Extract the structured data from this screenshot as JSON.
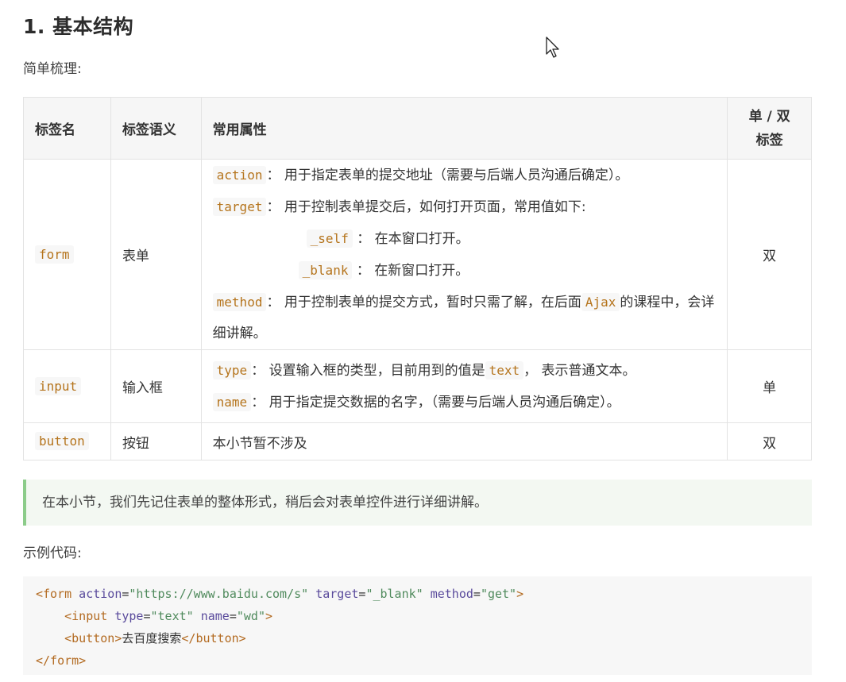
{
  "heading": "1. 基本结构",
  "intro": "简单梳理:",
  "table": {
    "headers": {
      "name": "标签名",
      "meaning": "标签语义",
      "attrs": "常用属性",
      "type_line1": "单 / 双",
      "type_line2": "标签"
    },
    "form": {
      "tag": "form",
      "meaning": "表单",
      "type": "双",
      "action_code": "action",
      "action_text": "： 用于指定表单的提交地址（需要与后端人员沟通后确定）。",
      "target_code": "target",
      "target_text": "： 用于控制表单提交后，如何打开页面，常用值如下:",
      "self_code": "_self",
      "self_text": " ： 在本窗口打开。",
      "blank_code": "_blank",
      "blank_text": " ： 在新窗口打开。",
      "method_code": "method",
      "method_text": "： 用于控制表单的提交方式，暂时只需了解，在后面",
      "ajax_code": "Ajax",
      "method_text2": "的课程中，会详细讲解。"
    },
    "input": {
      "tag": "input",
      "meaning": "输入框",
      "type": "单",
      "type_code": "type",
      "type_text1": "： 设置输入框的类型，目前用到的值是",
      "text_code": "text",
      "type_text2": "， 表示普通文本。",
      "name_code": "name",
      "name_text": "： 用于指定提交数据的名字，（需要与后端人员沟通后确定）。"
    },
    "button": {
      "tag": "button",
      "meaning": "按钮",
      "attrs": "本小节暂不涉及",
      "type": "双"
    }
  },
  "tip": "在本小节，我们先记住表单的整体形式，稍后会对表单控件进行详细讲解。",
  "example_label": "示例代码:",
  "code": {
    "l1_open": "<form",
    "l1_attr1": " action",
    "l1_eq1": "=",
    "l1_val1": "\"https://www.baidu.com/s\"",
    "l1_attr2": " target",
    "l1_eq2": "=",
    "l1_val2": "\"_blank\"",
    "l1_attr3": " method",
    "l1_eq3": "=",
    "l1_val3": "\"get\"",
    "l1_close": ">",
    "l2_indent": "    ",
    "l2_open": "<input",
    "l2_attr1": " type",
    "l2_eq1": "=",
    "l2_val1": "\"text\"",
    "l2_attr2": " name",
    "l2_eq2": "=",
    "l2_val2": "\"wd\"",
    "l2_close": ">",
    "l3_indent": "    ",
    "l3_open": "<button>",
    "l3_text": "去百度搜索",
    "l3_close": "</button>",
    "l4": "</form>"
  }
}
